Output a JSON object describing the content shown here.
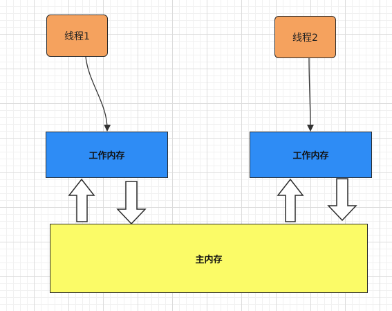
{
  "diagram": {
    "thread1_label": "线程1",
    "thread2_label": "线程2",
    "work_memory1_label": "工作内存",
    "work_memory2_label": "工作内存",
    "main_memory_label": "主内存"
  },
  "colors": {
    "thread_fill": "#f5a25e",
    "work_memory_fill": "#2e8cf5",
    "main_memory_fill": "#fbfb67",
    "stroke": "#2b2b2b",
    "arrow_fill": "#ffffff"
  }
}
